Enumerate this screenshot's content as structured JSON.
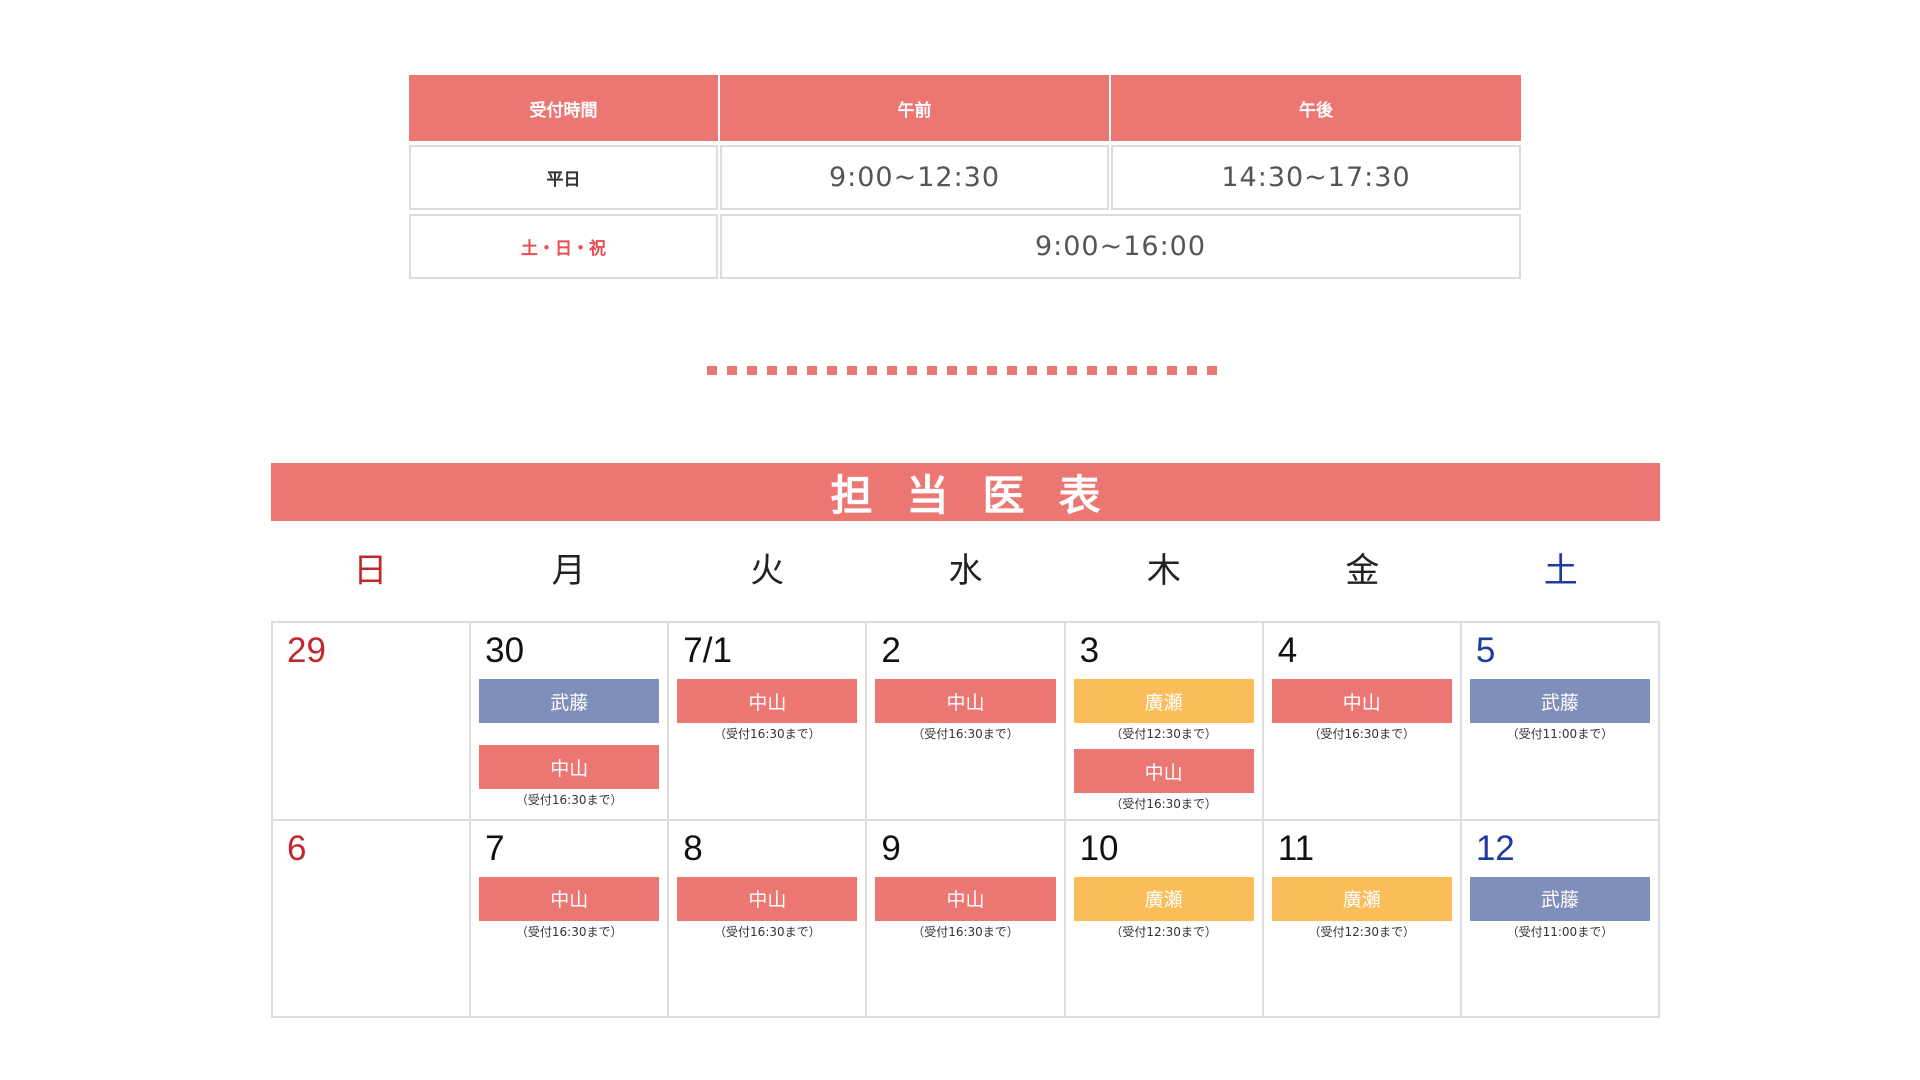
{
  "hours_table": {
    "header": {
      "label": "受付時間",
      "am": "午前",
      "pm": "午後"
    },
    "weekday": {
      "label": "平日",
      "am": "9:00~12:30",
      "pm": "14:30~17:30"
    },
    "weekend": {
      "label": "土・日・祝",
      "all_day": "9:00~16:00"
    },
    "colors": {
      "header_bg": "#ec7672",
      "holiday_text": "#ec4b50"
    }
  },
  "schedule": {
    "title": "担当医表",
    "weekdays": [
      "日",
      "月",
      "火",
      "水",
      "木",
      "金",
      "土"
    ],
    "colors": {
      "nakayama": "#ec7672",
      "muto": "#7f8fb9",
      "hirose": "#fbbd59",
      "sunday": "#c0282c",
      "saturday": "#1e3ca0"
    },
    "weeks": [
      [
        {
          "date": "29",
          "entries": []
        },
        {
          "date": "30",
          "entries": [
            {
              "doctor": "武藤",
              "color": "blue",
              "note": ""
            },
            {
              "doctor": "中山",
              "color": "red",
              "note": "（受付16:30まで）"
            }
          ]
        },
        {
          "date": "7/1",
          "entries": [
            {
              "doctor": "中山",
              "color": "red",
              "note": "（受付16:30まで）"
            }
          ]
        },
        {
          "date": "2",
          "entries": [
            {
              "doctor": "中山",
              "color": "red",
              "note": "（受付16:30まで）"
            }
          ]
        },
        {
          "date": "3",
          "entries": [
            {
              "doctor": "廣瀬",
              "color": "orange",
              "note": "（受付12:30まで）"
            },
            {
              "doctor": "中山",
              "color": "red",
              "note": "（受付16:30まで）"
            }
          ]
        },
        {
          "date": "4",
          "entries": [
            {
              "doctor": "中山",
              "color": "red",
              "note": "（受付16:30まで）"
            }
          ]
        },
        {
          "date": "5",
          "entries": [
            {
              "doctor": "武藤",
              "color": "blue",
              "note": "（受付11:00まで）"
            }
          ]
        }
      ],
      [
        {
          "date": "6",
          "entries": []
        },
        {
          "date": "7",
          "entries": [
            {
              "doctor": "中山",
              "color": "red",
              "note": "（受付16:30まで）"
            }
          ]
        },
        {
          "date": "8",
          "entries": [
            {
              "doctor": "中山",
              "color": "red",
              "note": "（受付16:30まで）"
            }
          ]
        },
        {
          "date": "9",
          "entries": [
            {
              "doctor": "中山",
              "color": "red",
              "note": "（受付16:30まで）"
            }
          ]
        },
        {
          "date": "10",
          "entries": [
            {
              "doctor": "廣瀬",
              "color": "orange",
              "note": "（受付12:30まで）"
            }
          ]
        },
        {
          "date": "11",
          "entries": [
            {
              "doctor": "廣瀬",
              "color": "orange",
              "note": "（受付12:30まで）"
            }
          ]
        },
        {
          "date": "12",
          "entries": [
            {
              "doctor": "武藤",
              "color": "blue",
              "note": "（受付11:00まで）"
            }
          ]
        }
      ]
    ]
  }
}
